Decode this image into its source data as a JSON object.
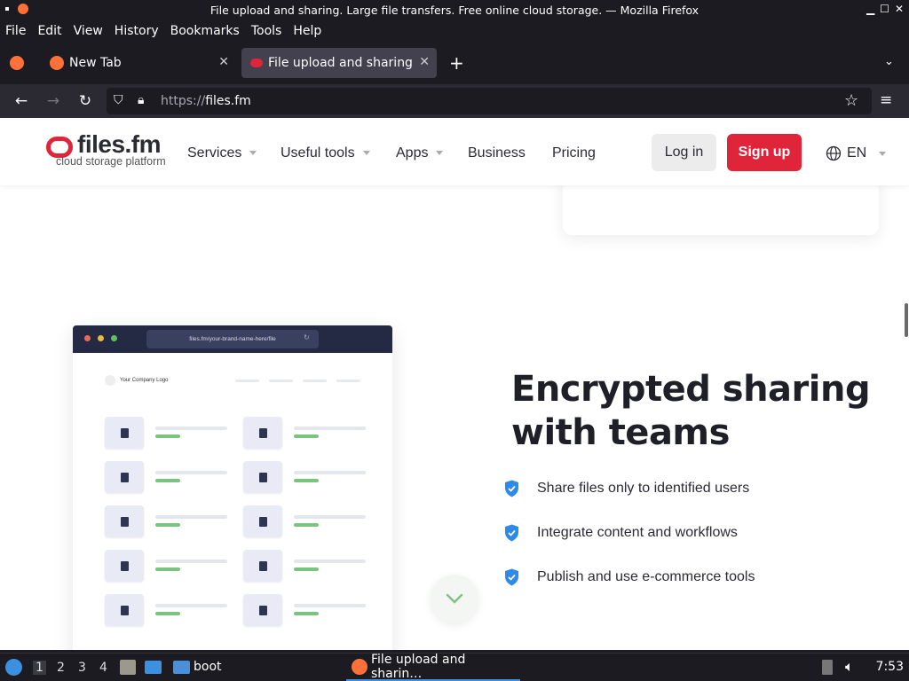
{
  "window": {
    "title": "File upload and sharing. Large file transfers. Free online cloud storage. — Mozilla Firefox"
  },
  "menubar": {
    "items": [
      "File",
      "Edit",
      "View",
      "History",
      "Bookmarks",
      "Tools",
      "Help"
    ]
  },
  "tabs": [
    {
      "label": "New Tab",
      "active": false
    },
    {
      "label": "File upload and sharing. l",
      "active": true
    }
  ],
  "navbar": {
    "url_prefix": "https://",
    "url_host": "files.fm"
  },
  "site": {
    "logo_text": "files.fm",
    "logo_tagline": "cloud storage platform",
    "nav": [
      "Services",
      "Useful tools",
      "Apps",
      "Business",
      "Pricing"
    ],
    "login_label": "Log in",
    "signup_label": "Sign up",
    "lang": "EN",
    "mockup": {
      "url": "files.fm/your-brand-name-here/file",
      "company_logo": "Your Company Logo"
    },
    "headline": "Encrypted sharing with teams",
    "features": [
      "Share files only to identified users",
      "Integrate content and workflows",
      "Publish and use e-commerce tools"
    ]
  },
  "taskbar": {
    "workspaces": [
      "1",
      "2",
      "3",
      "4"
    ],
    "folder_label": "boot",
    "window_label": "File upload and sharin…",
    "clock": "7:53"
  },
  "colors": {
    "brand_red": "#e0243a",
    "shield_blue": "#2e8ae6",
    "mock_green": "#7bc47f"
  }
}
